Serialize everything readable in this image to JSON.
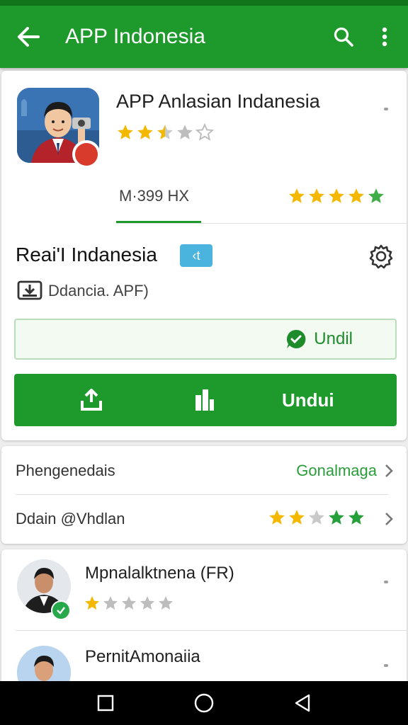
{
  "appbar": {
    "title": "APP Indonesia"
  },
  "app": {
    "name": "APP Anlasian Indanesia",
    "rating_stars": 2.5,
    "version": "M·399 HX",
    "version_rating_stars": 4.5
  },
  "section": {
    "title": "ReaiʹI Indanesia",
    "pill": "‹t",
    "size_label": "Ddancia. APF)"
  },
  "buttons": {
    "outline_label": "Undil",
    "solid_label": "Undui"
  },
  "rows": [
    {
      "left": "Phengenedais",
      "right": "Gonalmaga"
    },
    {
      "left": "Ddain @Vhdlan",
      "right": ""
    }
  ],
  "reviews": [
    {
      "name": "Mpnalalktnena (FR)",
      "stars": 1
    },
    {
      "name": "PernitAmonaiia",
      "stars": 0
    }
  ],
  "colors": {
    "primary": "#1e9a2c",
    "star": "#f5b800",
    "star_empty": "#bdbdbd"
  },
  "icons": [
    "back-arrow-icon",
    "search-icon",
    "more-vert-icon",
    "settings-gear-icon",
    "download-box-icon",
    "whatsapp-icon",
    "upload-icon",
    "chart-icon",
    "chevron-right-icon",
    "square-recents-icon",
    "circle-home-icon",
    "triangle-back-icon"
  ]
}
